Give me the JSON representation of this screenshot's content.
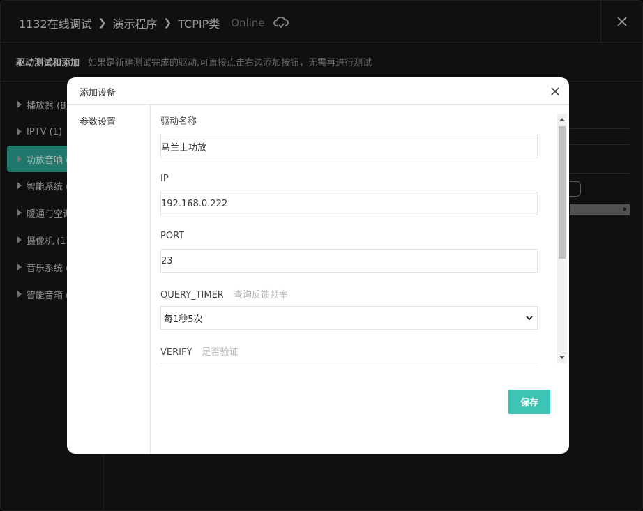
{
  "header": {
    "crumbs": [
      "1132在线调试",
      "演示程序",
      "TCPIP类"
    ],
    "status": "Online",
    "close_icon": "close-icon"
  },
  "subheader": {
    "title": "驱动测试和添加",
    "hint": "如果是新建测试完成的驱动,可直接点击右边添加按钮，无需再进行测试"
  },
  "sidebar": {
    "items": [
      {
        "label": "播放器 (8)"
      },
      {
        "label": "IPTV (1)"
      },
      {
        "label": "功放音响 (6)"
      },
      {
        "label": "智能系统 (5)"
      },
      {
        "label": "暖通与空调"
      },
      {
        "label": "摄像机 (1)"
      },
      {
        "label": "音乐系统 (1)"
      },
      {
        "label": "智能音箱 (1)"
      }
    ],
    "active_index": 2
  },
  "modal": {
    "title": "添加设备",
    "tab": "参数设置",
    "fields": {
      "driver_name_label": "驱动名称",
      "driver_name_value": "马兰士功放",
      "ip_label": "IP",
      "ip_value": "192.168.0.222",
      "port_label": "PORT",
      "port_value": "23",
      "query_timer_label": "QUERY_TIMER",
      "query_timer_hint": "查询反馈频率",
      "query_timer_value": "每1秒5次",
      "verify_label": "VERIFY",
      "verify_hint": "是否验证"
    },
    "save_label": "保存"
  },
  "colors": {
    "accent": "#3cc5b4",
    "sidebar_active": "#2e9f92"
  }
}
